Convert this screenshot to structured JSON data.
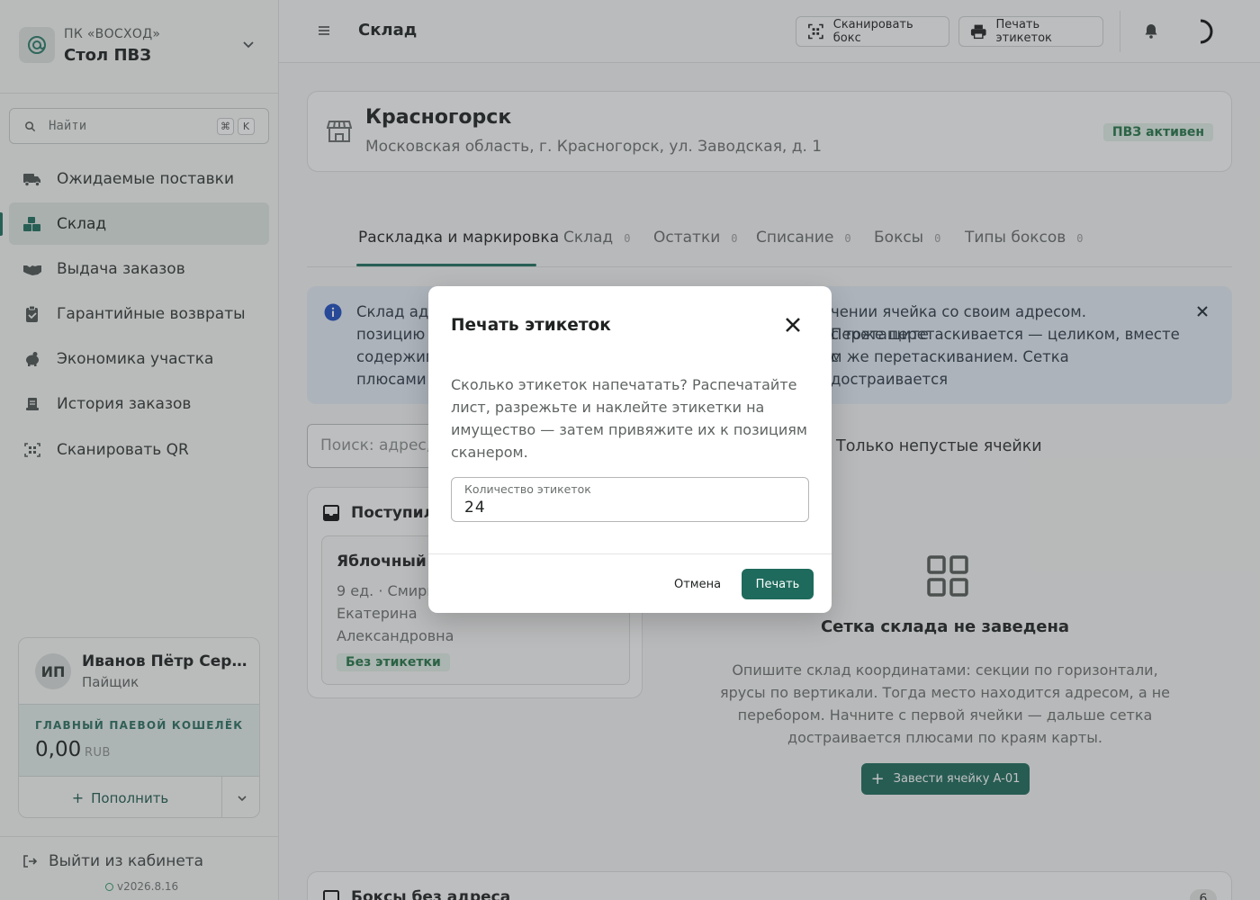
{
  "org": {
    "subtitle": "ПК «ВОСХОД»",
    "name": "Стол ПВЗ"
  },
  "search": {
    "placeholder": "Найти",
    "kbd_mod": "⌘",
    "kbd_key": "K"
  },
  "sidebar": {
    "items": [
      {
        "label": "Ожидаемые поставки",
        "icon": "truck-icon"
      },
      {
        "label": "Склад",
        "icon": "boxes-icon"
      },
      {
        "label": "Выдача заказов",
        "icon": "handshake-icon"
      },
      {
        "label": "Гарантийные возвраты",
        "icon": "clipboard-check-icon"
      },
      {
        "label": "Экономика участка",
        "icon": "piggy-bank-icon"
      },
      {
        "label": "История заказов",
        "icon": "receipt-icon"
      },
      {
        "label": "Сканировать QR",
        "icon": "qr-scan-icon"
      }
    ],
    "active_index": 1
  },
  "user": {
    "initials": "ИП",
    "name": "Иванов Пётр Сергеевич",
    "role": "Пайщик",
    "wallet_label": "ГЛАВНЫЙ ПАЕВОЙ КОШЕЛЁК",
    "wallet_amount": "0,00",
    "wallet_currency": "RUB",
    "topup_label": "Пополнить"
  },
  "footer": {
    "logout_label": "Выйти из кабинета",
    "version": "v2026.8.16"
  },
  "topbar": {
    "title": "Склад",
    "scan_box_label": "Сканировать бокс",
    "print_labels_label": "Печать этикеток"
  },
  "location": {
    "name": "Красногорск",
    "address": "Московская область, г. Красногорск, ул. Заводская, д. 1",
    "status": "ПВЗ активен"
  },
  "tabs": [
    {
      "label": "Раскладка и маркировка",
      "count": ""
    },
    {
      "label": "Склад",
      "count": "0"
    },
    {
      "label": "Остатки",
      "count": "0"
    },
    {
      "label": "Списание",
      "count": "0"
    },
    {
      "label": "Боксы",
      "count": "0"
    },
    {
      "label": "Типы боксов",
      "count": "0"
    }
  ],
  "info_banner": {
    "text_left": "Склад адр",
    "text_right_1": "чении ячейка со своим адресом. Перетащите",
    "line2_left": "позицию в",
    "text_right_2": "с тоже перетаскивается — целиком, вместе с",
    "line3_left": "содержим",
    "text_right_3": "м же перетаскиванием. Сетка достраивается",
    "line4_left": "плюсами п"
  },
  "filter": {
    "placeholder": "Поиск: адрес,",
    "toggle_label": "Только непустые ячейки"
  },
  "incoming": {
    "title": "Поступило",
    "item": {
      "title": "Яблочный с",
      "meta_1": "9 ед. · Смирн",
      "meta_2": "Екатерина",
      "meta_3": "Александровна",
      "badge": "Без этикетки"
    }
  },
  "empty_state": {
    "title": "Сетка склада не заведена",
    "description": "Опишите склад координатами: секции по горизонтали, ярусы по вертикали. Тогда место находится адресом, а не перебором. Начните с первой ячейки — дальше сетка достраивается плюсами по краям карты.",
    "button_label": "Завести ячейку A-01"
  },
  "boxes_section": {
    "title": "Боксы без адреса",
    "count": "6"
  },
  "modal": {
    "title": "Печать этикеток",
    "text": "Сколько этикеток напечатать? Распечатайте лист, разрежьте и наклейте этикетки на имущество — затем привяжите их к позициям сканером.",
    "field_label": "Количество этикеток",
    "field_value": "24",
    "cancel_label": "Отмена",
    "print_label": "Печать"
  },
  "colors": {
    "accent": "#1e6a5c",
    "badge_bg": "#e1ede6",
    "badge_text": "#247548",
    "info_bg": "#e3ebf5"
  }
}
